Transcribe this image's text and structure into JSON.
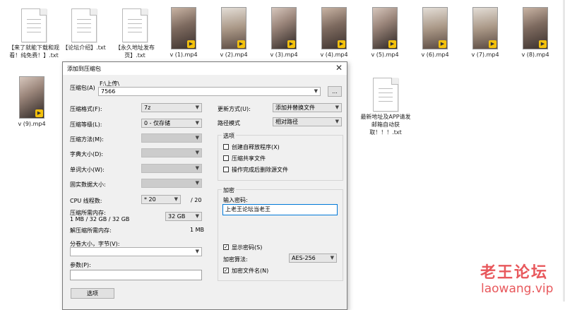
{
  "files": [
    {
      "name": "【来了就能下载和观看！纯免费！】.txt",
      "kind": "doc"
    },
    {
      "name": "【论坛介绍】.txt",
      "kind": "doc"
    },
    {
      "name": "【永久地址发布页】.txt",
      "kind": "doc"
    },
    {
      "name": "v (1).mp4",
      "kind": "video"
    },
    {
      "name": "v (2).mp4",
      "kind": "video"
    },
    {
      "name": "v (3).mp4",
      "kind": "video"
    },
    {
      "name": "v (4).mp4",
      "kind": "video"
    },
    {
      "name": "v (5).mp4",
      "kind": "video"
    },
    {
      "name": "v (6).mp4",
      "kind": "video"
    },
    {
      "name": "v (7).mp4",
      "kind": "video"
    },
    {
      "name": "v (8).mp4",
      "kind": "video"
    },
    {
      "name": "v (9).mp4",
      "kind": "video"
    },
    {
      "name": "最新地址及APP请发邮箱自动获取！！！.txt",
      "kind": "doc"
    }
  ],
  "dialog": {
    "title": "添加到压缩包",
    "archive_label": "压缩包(A)",
    "archive_path": "F:\\上传\\",
    "archive_name": "7566",
    "browse_label": "...",
    "format_label": "压缩格式(F):",
    "format_value": "7z",
    "level_label": "压缩等级(L):",
    "level_value": "0 - 仅存储",
    "method_label": "压缩方法(M):",
    "dict_label": "字典大小(D):",
    "word_label": "单词大小(W):",
    "solid_label": "固实数据大小:",
    "cpu_label": "CPU 线程数:",
    "cpu_value": "20",
    "cpu_total": "/ 20",
    "mem_label": "压缩所需内存:",
    "mem_detail": "1 MB / 32 GB / 32 GB",
    "mem_value": "32 GB",
    "unmem_label": "解压缩所需内存:",
    "unmem_value": "1 MB",
    "split_label": "分卷大小，字节(V):",
    "params_label": "参数(P):",
    "options_button": "选项",
    "update_label": "更新方式(U):",
    "update_value": "添加并替换文件",
    "path_label": "路径模式",
    "path_value": "相对路径",
    "options_group": "选项",
    "opt_sfx": "创建自释放程序(X)",
    "opt_shared": "压缩共享文件",
    "opt_delete": "操作完成后删除源文件",
    "encrypt_group": "加密",
    "pwd_label": "输入密码:",
    "pwd_value": "上老王论坛当老王",
    "show_pwd": "显示密码(S)",
    "enc_method_label": "加密算法:",
    "enc_method_value": "AES-256",
    "enc_names": "加密文件名(N)",
    "check_mark": "✓"
  },
  "watermark": {
    "line1": "老王论坛",
    "line2": "laowang.vip"
  }
}
